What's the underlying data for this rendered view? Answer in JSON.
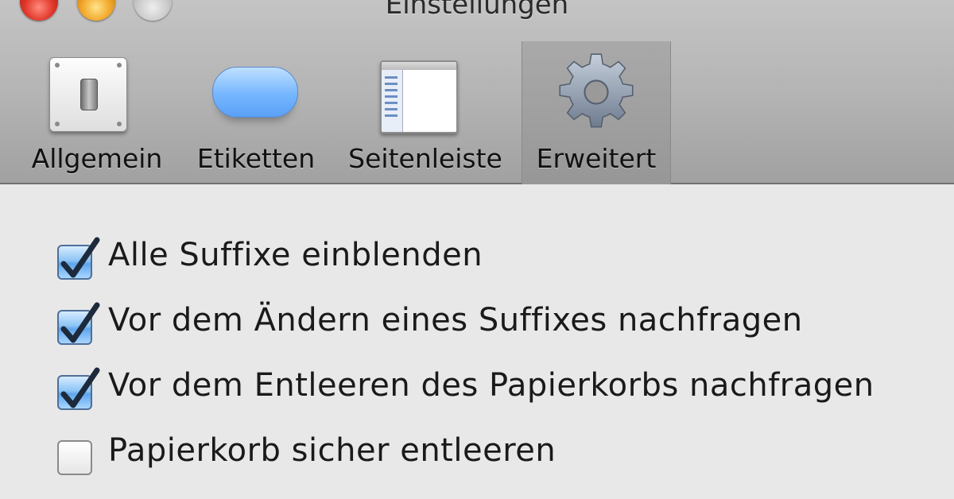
{
  "window": {
    "title": "Einstellungen"
  },
  "toolbar": {
    "tabs": [
      {
        "label": "Allgemein",
        "icon": "general-switch-icon",
        "selected": false
      },
      {
        "label": "Etiketten",
        "icon": "label-icon",
        "selected": false
      },
      {
        "label": "Seitenleiste",
        "icon": "sidebar-icon",
        "selected": false
      },
      {
        "label": "Erweitert",
        "icon": "gear-icon",
        "selected": true
      }
    ]
  },
  "preferences": [
    {
      "label": "Alle Suffixe einblenden",
      "checked": true
    },
    {
      "label": "Vor dem Ändern eines Suffixes nachfragen",
      "checked": true
    },
    {
      "label": "Vor dem Entleeren des Papierkorbs nachfragen",
      "checked": true
    },
    {
      "label": "Papierkorb sicher entleeren",
      "checked": false
    }
  ],
  "colors": {
    "label_tag": "#75b6ff",
    "checkbox_checked": "#5ea5ec",
    "close_button": "#e0382a",
    "minimize_button": "#f2a72a"
  }
}
